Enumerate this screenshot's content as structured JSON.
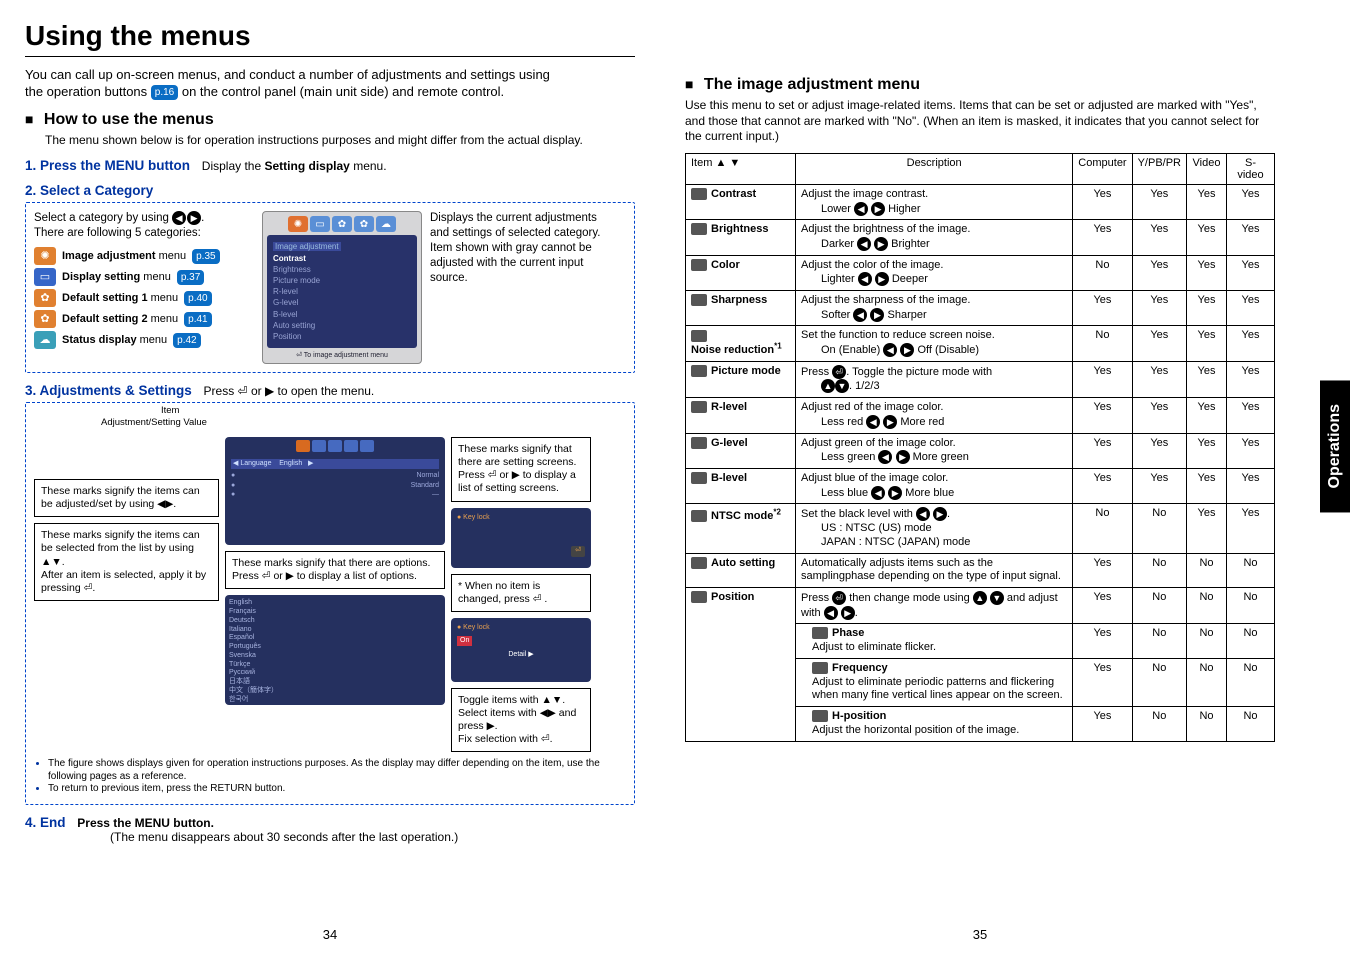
{
  "title": "Using the menus",
  "intro_line1": "You can call up on-screen menus, and conduct a number of adjustments and settings using",
  "intro_line2_pre": "the operation buttons ",
  "intro_line2_post": " on the control panel (main unit side) and remote control.",
  "p16_ref": "p.16",
  "section_howto": "How to use the menus",
  "howto_desc": "The menu shown below is for operation instructions purposes and might differ from the actual display.",
  "step1": "1. Press the MENU button",
  "step1_sub_pre": "Display the ",
  "step1_sub_bold": "Setting display",
  "step1_sub_post": " menu.",
  "step2": "2. Select a Category",
  "step2_select": "Select a category by using ",
  "step2_select2": "There are following 5 categories:",
  "cats": [
    {
      "label": "Image adjustment",
      "suffix": " menu",
      "ref": "p.35"
    },
    {
      "label": "Display setting",
      "suffix": " menu",
      "ref": "p.37"
    },
    {
      "label": "Default setting 1",
      "suffix": " menu",
      "ref": "p.40"
    },
    {
      "label": "Default setting 2",
      "suffix": " menu",
      "ref": "p.41"
    },
    {
      "label": "Status display",
      "suffix": " menu",
      "ref": "p.42"
    }
  ],
  "cat_right": "Displays the current adjustments and settings of selected category.\nItem shown with gray cannot be adjusted with the current input source.",
  "step3": "3. Adjustments & Settings",
  "step3_sub": "Press ⏎ or ▶ to open the menu.",
  "label_item": "Item",
  "label_adj": "Adjustment/Setting Value",
  "adj_textbox1": "These marks signify the items can be adjusted/set by using ◀▶.",
  "adj_textbox2": "These marks signify the items can be selected from the list by using ▲▼.\nAfter an item is selected, apply it by pressing ⏎.",
  "adj_mid_text": "These marks signify that there are options.\nPress ⏎ or ▶ to display a list of options.",
  "adj_right1": "These marks signify that there are setting screens. Press ⏎ or ▶ to display a list of setting screens.",
  "adj_right2": "* When no item is changed, press ⏎ .",
  "adj_right3": "Toggle items with ▲▼.\nSelect items with ◀▶ and press ▶.\nFix selection with ⏎.",
  "bullets": [
    "The figure shows displays given for operation instructions purposes.  As the display may differ depending on the item, use the following pages as a reference.",
    "To return to previous item, press the RETURN button."
  ],
  "step4": "4. End",
  "step4_sub": "Press the MENU button.",
  "step4_note": "(The menu disappears about 30 seconds after the last operation.)",
  "section_image_adj": "The image adjustment menu",
  "image_adj_desc": "Use this menu to set or adjust image-related items. Items that can be set or adjusted are marked with \"Yes\", and those that cannot are marked with \"No\". (When an item is masked, it indicates that you cannot select for the current input.)",
  "table_headers": [
    "Item ▲ ▼",
    "Description",
    "Computer",
    "Y/PB/PR",
    "Video",
    "S-video"
  ],
  "rows": [
    {
      "name": "Contrast",
      "desc": "Adjust the image contrast.",
      "opts": "Lower  ◀  ▶  Higher",
      "v": [
        "Yes",
        "Yes",
        "Yes",
        "Yes"
      ]
    },
    {
      "name": "Brightness",
      "desc": "Adjust the brightness of the image.",
      "opts": "Darker  ◀  ▶  Brighter",
      "v": [
        "Yes",
        "Yes",
        "Yes",
        "Yes"
      ]
    },
    {
      "name": "Color",
      "desc": "Adjust the color of the image.",
      "opts": "Lighter  ◀  ▶  Deeper",
      "v": [
        "No",
        "Yes",
        "Yes",
        "Yes"
      ]
    },
    {
      "name": "Sharpness",
      "desc": "Adjust the sharpness of the image.",
      "opts": "Softer  ◀  ▶  Sharper",
      "v": [
        "Yes",
        "Yes",
        "Yes",
        "Yes"
      ]
    },
    {
      "name": "Noise reduction",
      "sup": "*1",
      "desc": "Set the function to reduce screen noise.",
      "opts": "On (Enable)  ◀  ▶  Off (Disable)",
      "v": [
        "No",
        "Yes",
        "Yes",
        "Yes"
      ]
    },
    {
      "name": "Picture mode",
      "desc": "Press ⏎. Toggle the picture mode with",
      "opts": "▲▼.    1/2/3",
      "v": [
        "Yes",
        "Yes",
        "Yes",
        "Yes"
      ]
    },
    {
      "name": "R-level",
      "desc": "Adjust red of the image color.",
      "opts": "Less red  ◀  ▶  More red",
      "v": [
        "Yes",
        "Yes",
        "Yes",
        "Yes"
      ]
    },
    {
      "name": "G-level",
      "desc": "Adjust green of the image color.",
      "opts": "Less green  ◀  ▶  More green",
      "v": [
        "Yes",
        "Yes",
        "Yes",
        "Yes"
      ]
    },
    {
      "name": "B-level",
      "desc": "Adjust blue of the image color.",
      "opts": "Less blue  ◀  ▶  More blue",
      "v": [
        "Yes",
        "Yes",
        "Yes",
        "Yes"
      ]
    },
    {
      "name": "NTSC mode",
      "sup": "*2",
      "desc": "Set the black level with ◀ ▶.",
      "opts": "US            :  NTSC (US) mode\nJAPAN      :  NTSC (JAPAN) mode",
      "v": [
        "No",
        "No",
        "Yes",
        "Yes"
      ]
    },
    {
      "name": "Auto setting",
      "desc": "Automatically adjusts items such as the samplingphase depending on the type of input signal.",
      "opts": "",
      "v": [
        "Yes",
        "No",
        "No",
        "No"
      ]
    },
    {
      "name": "Position",
      "desc": "Press ⏎ then change mode using ▲ ▼ and adjust with ◀ ▶.",
      "opts": "",
      "v": [
        "Yes",
        "No",
        "No",
        "No"
      ]
    }
  ],
  "subrows": [
    {
      "name": "Phase",
      "desc": "Adjust to eliminate flicker.",
      "v": [
        "Yes",
        "No",
        "No",
        "No"
      ]
    },
    {
      "name": "Frequency",
      "desc": "Adjust to eliminate periodic patterns and flickering when many fine vertical lines appear on the screen.",
      "v": [
        "Yes",
        "No",
        "No",
        "No"
      ]
    },
    {
      "name": "H-position",
      "desc": "Adjust the horizontal position of the image.",
      "v": [
        "Yes",
        "No",
        "No",
        "No"
      ]
    }
  ],
  "side_tab": "Operations",
  "page_left": "34",
  "page_right": "35"
}
